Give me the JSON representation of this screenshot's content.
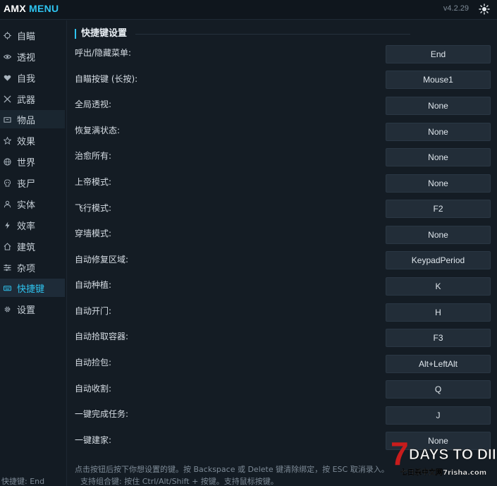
{
  "titlebar": {
    "title_main": "AMX",
    "title_accent": "MENU",
    "version": "v4.2.29"
  },
  "sidebar": {
    "items": [
      {
        "label": "自瞄",
        "icon": "crosshair-icon"
      },
      {
        "label": "透视",
        "icon": "eye-icon"
      },
      {
        "label": "自我",
        "icon": "heart-icon"
      },
      {
        "label": "武器",
        "icon": "swords-icon"
      },
      {
        "label": "物品",
        "icon": "box-icon"
      },
      {
        "label": "效果",
        "icon": "star-icon"
      },
      {
        "label": "世界",
        "icon": "globe-icon"
      },
      {
        "label": "丧尸",
        "icon": "skull-icon"
      },
      {
        "label": "实体",
        "icon": "user-icon"
      },
      {
        "label": "效率",
        "icon": "bolt-icon"
      },
      {
        "label": "建筑",
        "icon": "home-icon"
      },
      {
        "label": "杂项",
        "icon": "sliders-icon"
      },
      {
        "label": "快捷键",
        "icon": "keyboard-icon"
      },
      {
        "label": "设置",
        "icon": "gear-icon"
      }
    ],
    "footer": "快捷键: End"
  },
  "main": {
    "section_title": "快捷键设置",
    "rows": [
      {
        "label": "呼出/隐藏菜单:",
        "key": "End"
      },
      {
        "label": "自瞄按键 (长按):",
        "key": "Mouse1"
      },
      {
        "label": "全局透视:",
        "key": "None"
      },
      {
        "label": "恢复满状态:",
        "key": "None"
      },
      {
        "label": "治愈所有:",
        "key": "None"
      },
      {
        "label": "上帝模式:",
        "key": "None"
      },
      {
        "label": "飞行模式:",
        "key": "F2"
      },
      {
        "label": "穿墙模式:",
        "key": "None"
      },
      {
        "label": "自动修复区域:",
        "key": "KeypadPeriod"
      },
      {
        "label": "自动种植:",
        "key": "K"
      },
      {
        "label": "自动开门:",
        "key": "H"
      },
      {
        "label": "自动拾取容器:",
        "key": "F3"
      },
      {
        "label": "自动捡包:",
        "key": "Alt+LeftAlt"
      },
      {
        "label": "自动收割:",
        "key": "Q"
      },
      {
        "label": "一键完成任务:",
        "key": "J"
      },
      {
        "label": "一键建家:",
        "key": "None"
      }
    ],
    "hint_line1": "点击按钮后按下你想设置的键。按 Backspace 或 Delete 键清除绑定，按 ESC 取消录入。",
    "hint_line2": "支持组合键: 按住 Ctrl/Alt/Shift + 按键。支持鼠标按键。"
  },
  "watermark": {
    "logo_text": "DAYS TO DIE",
    "logo_digit": "7",
    "site_text": "七日杀中文网7risha.com"
  },
  "colors": {
    "accent": "#2ec4f0",
    "background": "#141c24",
    "button": "#222d38"
  }
}
